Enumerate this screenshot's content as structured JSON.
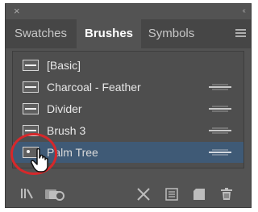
{
  "window": {
    "close_glyph": "×",
    "collapse_glyph": "‹‹"
  },
  "tabs": [
    {
      "label": "Swatches",
      "active": false
    },
    {
      "label": "Brushes",
      "active": true
    },
    {
      "label": "Symbols",
      "active": false
    }
  ],
  "brushes": [
    {
      "label": "[Basic]",
      "type_icon": null,
      "selected": false
    },
    {
      "label": "Charcoal - Feather",
      "type_icon": "art-brush-icon",
      "selected": false
    },
    {
      "label": "Divider",
      "type_icon": "art-brush-icon",
      "selected": false
    },
    {
      "label": "Brush 3",
      "type_icon": "art-brush-icon",
      "selected": false
    },
    {
      "label": "Palm Tree",
      "type_icon": "art-brush-icon",
      "selected": true
    }
  ],
  "bottom_toolbar": [
    {
      "name": "brush-libraries-menu-icon"
    },
    {
      "name": "libraries-panel-icon"
    },
    {
      "name": "remove-brush-stroke-icon"
    },
    {
      "name": "options-of-selected-object-icon"
    },
    {
      "name": "new-brush-icon"
    },
    {
      "name": "delete-brush-icon"
    }
  ],
  "colors": {
    "panel": "#535353",
    "selection": "#3f5a76",
    "highlight_ring": "#d6282b"
  }
}
